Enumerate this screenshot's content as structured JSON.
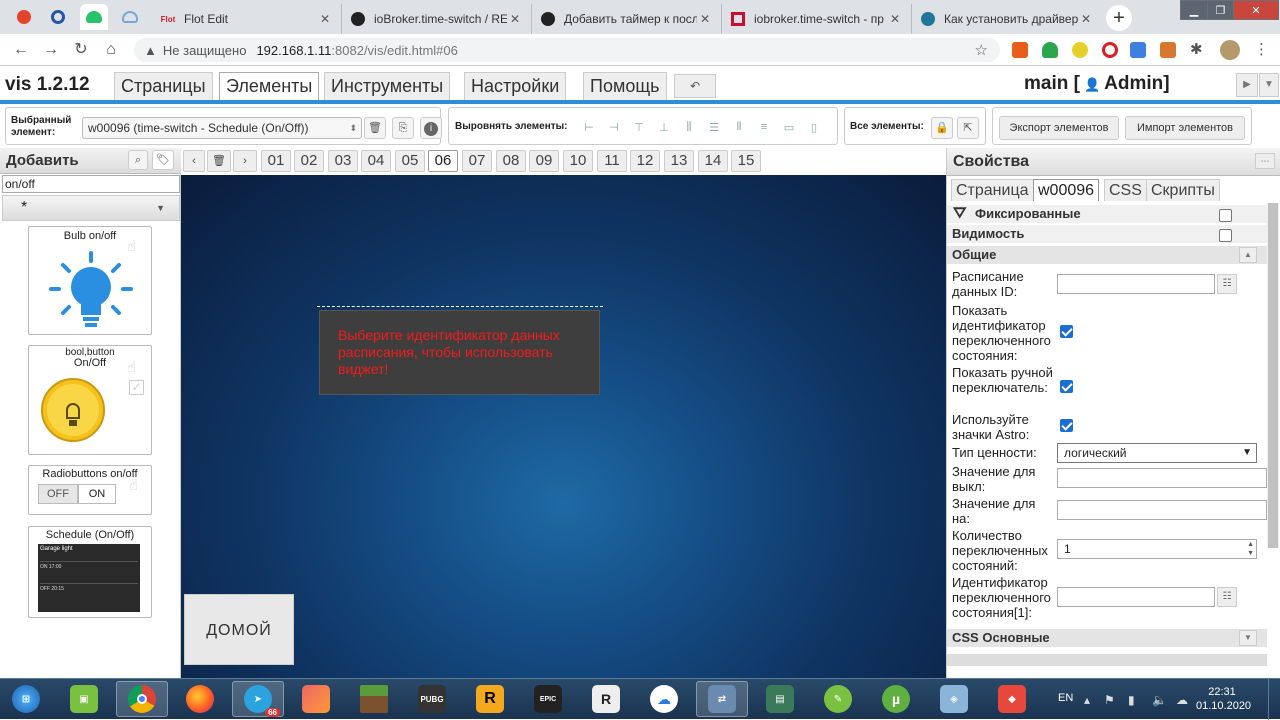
{
  "browser": {
    "tabs": [
      {
        "title": "Flot Edit",
        "favicon": "flot-icon"
      },
      {
        "title": "ioBroker.time-switch / REA",
        "favicon": "github-icon"
      },
      {
        "title": "Добавить таймер к посл",
        "favicon": "github-icon"
      },
      {
        "title": "iobroker.time-switch - пр",
        "favicon": "iobroker-icon"
      },
      {
        "title": "Как установить драйвер",
        "favicon": "wordpress-icon"
      }
    ],
    "active_tab_index": 0,
    "address": {
      "security_label": "Не защищено",
      "host": "192.168.1.11",
      "path": ":8082/vis/edit.html#06"
    }
  },
  "vis": {
    "title": "vis 1.2.12",
    "menu": [
      "Страницы",
      "Элементы",
      "Инструменты",
      "Настройки",
      "Помощь"
    ],
    "active_menu": "Элементы",
    "project": "main [",
    "user": "Admin]",
    "accent_color": "#2b8fd6"
  },
  "toolbar": {
    "selected_label_1": "Выбранный",
    "selected_label_2": "элемент:",
    "selected_widget": "w00096 (time-switch - Schedule (On/Off))",
    "align_label": "Выровнять элементы:",
    "all_label": "Все элементы:",
    "export_label": "Экспорт элементов",
    "import_label": "Импорт элементов"
  },
  "palette": {
    "title": "Добавить",
    "filter": "on/off",
    "set": "*",
    "widgets": [
      {
        "title": "Bulb on/off"
      },
      {
        "title_1": "bool,button",
        "title_2": "On/Off"
      },
      {
        "title": "Radiobuttons on/off",
        "off": "OFF",
        "on": "ON"
      },
      {
        "title": "Schedule (On/Off)",
        "preview_title": "Garage light",
        "row1": "ON  17:00",
        "row2": "OFF  20:15"
      }
    ]
  },
  "pages": {
    "tabs": [
      "01",
      "02",
      "03",
      "04",
      "05",
      "06",
      "07",
      "08",
      "09",
      "10",
      "11",
      "12",
      "13",
      "14",
      "15"
    ],
    "active": "06"
  },
  "canvas": {
    "widget_message": "Выберите идентификатор данных расписания, чтобы использовать виджет!",
    "widget_message_color": "#f31b1b",
    "home_button": "ДОМОЙ"
  },
  "properties": {
    "title": "Свойства",
    "tabs": [
      "Страница",
      "w00096",
      "CSS",
      "Скрипты"
    ],
    "active_tab": "w00096",
    "fixed_label": "Фиксированные",
    "visibility_label": "Видимость",
    "general_label": "Общие",
    "schedule_id_label": "Расписание данных ID:",
    "schedule_id_value": "",
    "show_state_id_label": "Показать идентификатор переключенного состояния:",
    "show_state_id": true,
    "show_manual_label": "Показать ручной переключатель:",
    "show_manual": true,
    "use_astro_label": "Используйте значки Astro:",
    "use_astro": true,
    "value_type_label": "Тип ценности:",
    "value_type": "логический",
    "off_value_label": "Значение для выкл:",
    "off_value": "",
    "on_value_label": "Значение для на:",
    "on_value": "",
    "state_count_label": "Количество переключенных состояний:",
    "state_count": "1",
    "state_id_label": "Идентификатор переключенного состояния[1]:",
    "state_id_value": "",
    "css_general_label": "CSS Основные"
  },
  "taskbar": {
    "lang": "EN",
    "time": "22:31",
    "date": "01.10.2020",
    "telegram_badge": "66"
  }
}
